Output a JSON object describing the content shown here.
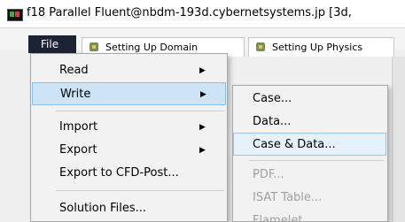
{
  "window": {
    "title": "f18 Parallel Fluent@nbdm-193d.cybernetsystems.jp  [3d,"
  },
  "menubar": {
    "file_label": "File"
  },
  "tabs": [
    {
      "label": "Setting Up Domain",
      "icon": "setup-domain-icon"
    },
    {
      "label": "Setting Up Physics",
      "icon": "setup-physics-icon"
    }
  ],
  "file_menu": {
    "items": [
      {
        "label": "Read",
        "submenu": true
      },
      {
        "label": "Write",
        "submenu": true,
        "highlighted": true
      },
      {
        "label": "Import",
        "submenu": true
      },
      {
        "label": "Export",
        "submenu": true
      },
      {
        "label": "Export to CFD-Post...",
        "submenu": false
      },
      {
        "label": "Solution Files...",
        "submenu": false
      }
    ]
  },
  "write_submenu": {
    "items": [
      {
        "label": "Case...",
        "enabled": true
      },
      {
        "label": "Data...",
        "enabled": true
      },
      {
        "label": "Case & Data...",
        "enabled": true,
        "highlighted": true
      },
      {
        "label": "PDF...",
        "enabled": false
      },
      {
        "label": "ISAT Table...",
        "enabled": false
      },
      {
        "label": "Flamelet...",
        "enabled": false
      }
    ]
  }
}
